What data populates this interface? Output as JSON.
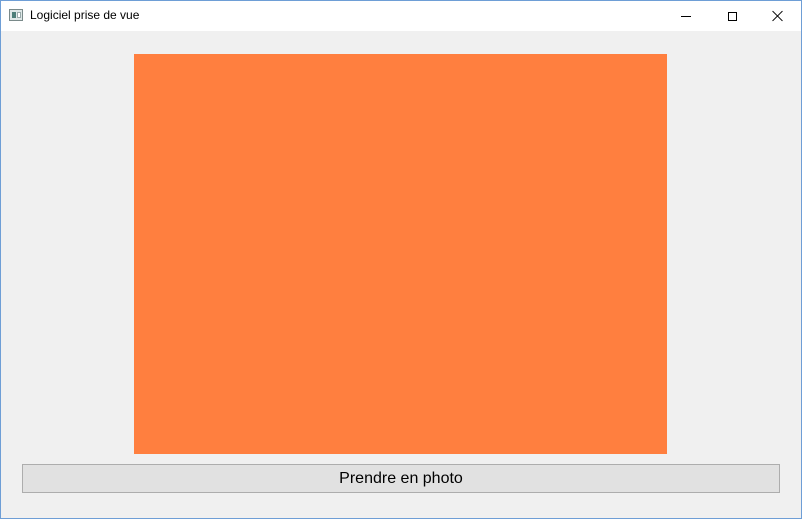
{
  "window": {
    "title": "Logiciel prise de vue"
  },
  "title_controls": {
    "minimize_icon": "minimize-icon",
    "maximize_icon": "maximize-icon",
    "close_icon": "close-icon"
  },
  "preview": {
    "color": "#ff7f3f"
  },
  "actions": {
    "shoot_label": "Prendre en photo"
  }
}
